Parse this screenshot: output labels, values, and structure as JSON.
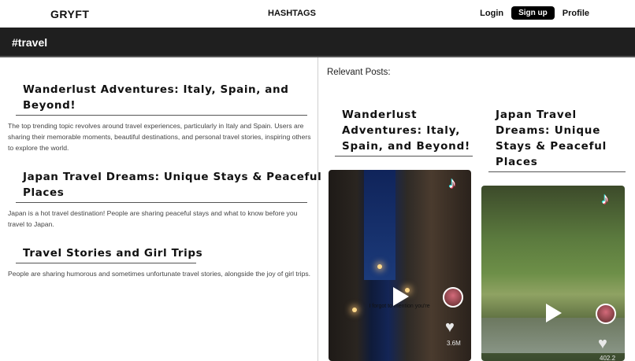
{
  "nav": {
    "logo": "GRYFT",
    "center_link": "HASHTAGS",
    "login": "Login",
    "signup": "Sign up",
    "profile": "Profile"
  },
  "banner": {
    "title": "#travel"
  },
  "topics": [
    {
      "title_line1": "Wanderlust Adventures: Italy, Spain, and",
      "title_line2": "Beyond!",
      "description": "The top trending topic revolves around travel experiences, particularly in Italy and Spain. Users are sharing their memorable moments, beautiful destinations, and personal travel stories, inspiring others to explore the world."
    },
    {
      "title_line1": "Japan Travel Dreams: Unique Stays & Peaceful",
      "title_line2": "Places",
      "description": "Japan is a hot travel destination! People are sharing peaceful stays and what to know before you travel to Japan."
    },
    {
      "title_line1": "Travel Stories and Girl Trips",
      "title_line2": "",
      "description": "People are sharing humorous and sometimes unfortunate travel stories, alongside the joy of girl trips."
    }
  ],
  "relevant": {
    "label": "Relevant Posts:",
    "cards": [
      {
        "title_lines": [
          "Wanderlust",
          "Adventures: Italy,",
          "Spain, and Beyond!"
        ],
        "likes": "3.6M",
        "caption": "I forgot to mention you're"
      },
      {
        "title_lines": [
          "Japan Travel",
          "Dreams: Unique",
          "Stays & Peaceful",
          "Places"
        ],
        "likes": "402.2"
      }
    ]
  },
  "icons": {
    "play": "play-icon",
    "tiktok": "tiktok-icon",
    "heart": "heart-icon",
    "avatar": "avatar"
  }
}
